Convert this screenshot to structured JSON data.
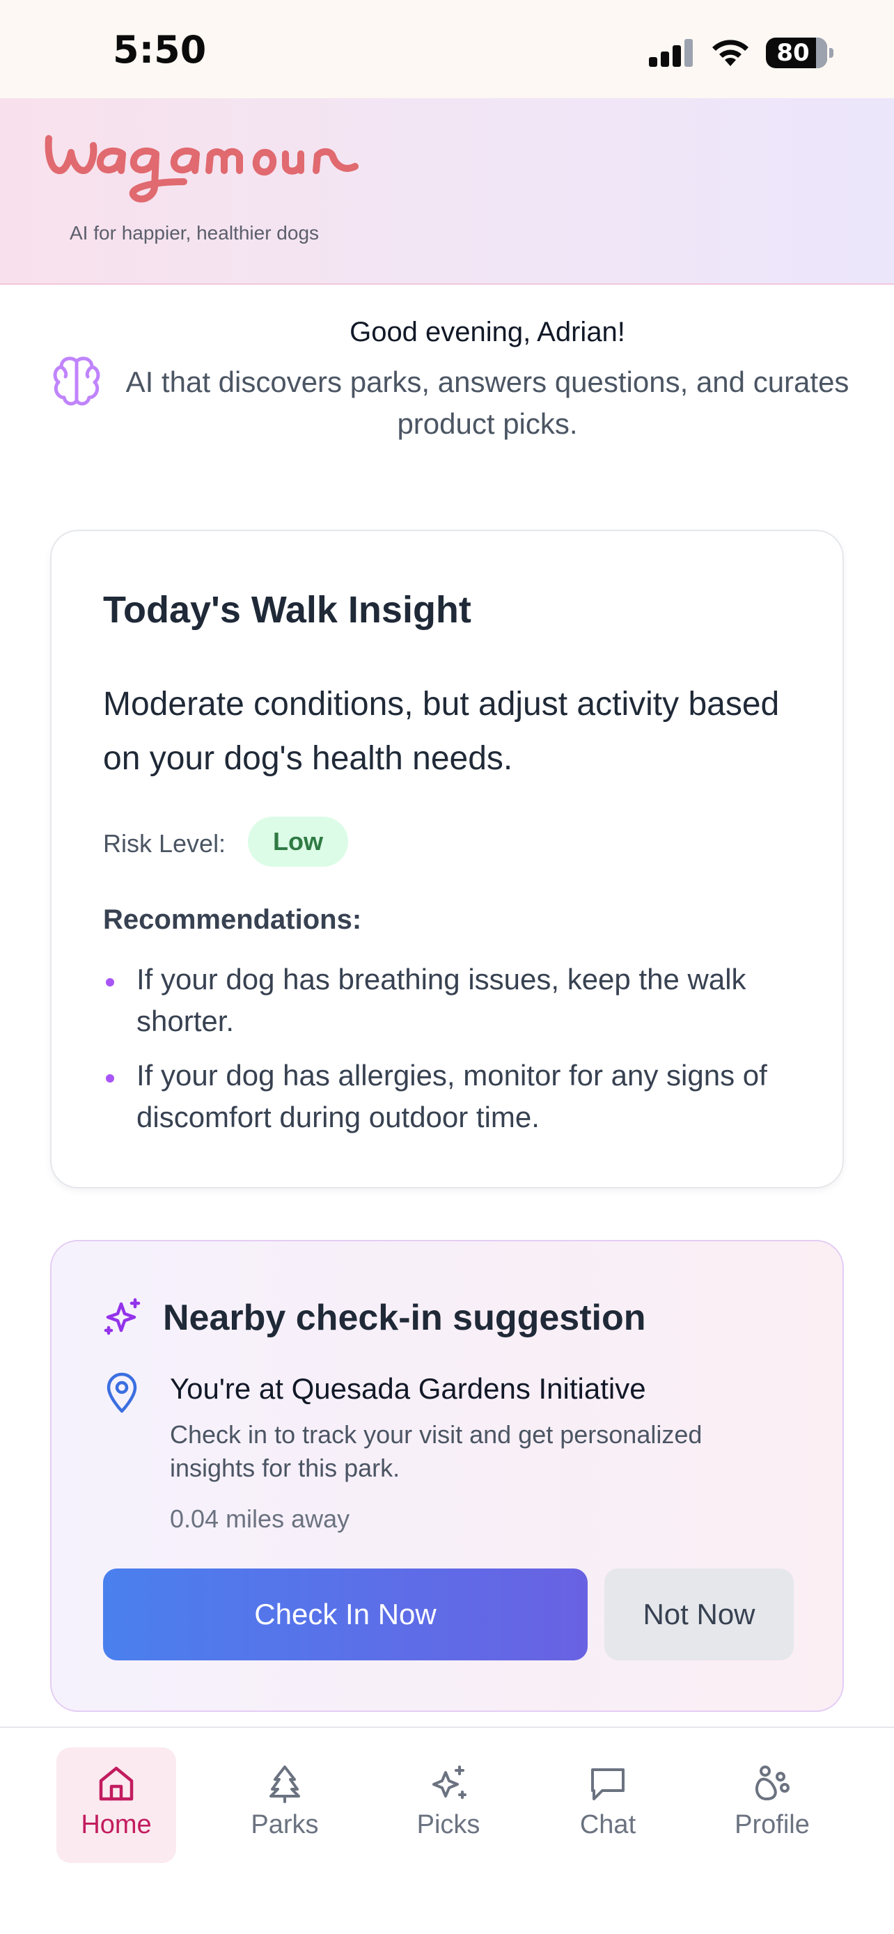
{
  "status_bar": {
    "time": "5:50",
    "battery": "80",
    "icons": [
      "signal-icon",
      "wifi-icon",
      "battery-icon"
    ]
  },
  "header": {
    "logo_text": "Wagamour",
    "tagline": "AI for happier, healthier dogs",
    "logo_color": "#e06a6f"
  },
  "greeting": {
    "title": "Good evening, Adrian!",
    "subtitle": "AI that discovers parks, answers questions, and curates product picks.",
    "icon": "brain-icon"
  },
  "walk_insight": {
    "title": "Today's Walk Insight",
    "summary": "Moderate conditions, but adjust activity based on your dog's health needs.",
    "risk_label": "Risk Level:",
    "risk_value": "Low",
    "recommendations_title": "Recommendations:",
    "recommendations": [
      "If your dog has breathing issues, keep the walk shorter.",
      "If your dog has allergies, monitor for any signs of discomfort during outdoor time."
    ]
  },
  "checkin": {
    "title": "Nearby check-in suggestion",
    "location_title": "You're at Quesada Gardens Initiative",
    "description": "Check in to track your visit and get personalized insights for this park.",
    "distance": "0.04 miles away",
    "primary_button": "Check In Now",
    "secondary_button": "Not Now"
  },
  "tabs": [
    {
      "label": "Home",
      "icon": "home-icon",
      "active": true
    },
    {
      "label": "Parks",
      "icon": "tree-icon",
      "active": false
    },
    {
      "label": "Picks",
      "icon": "sparkles-icon",
      "active": false
    },
    {
      "label": "Chat",
      "icon": "chat-bubble-icon",
      "active": false
    },
    {
      "label": "Profile",
      "icon": "paw-icon",
      "active": false
    }
  ],
  "colors": {
    "accent": "#c21c5e",
    "primary_button_start": "#4a80ee",
    "primary_button_end": "#6962e3",
    "risk_low_bg": "#dcfce7",
    "risk_low_text": "#2f7a44",
    "bullet": "#a855f7"
  }
}
